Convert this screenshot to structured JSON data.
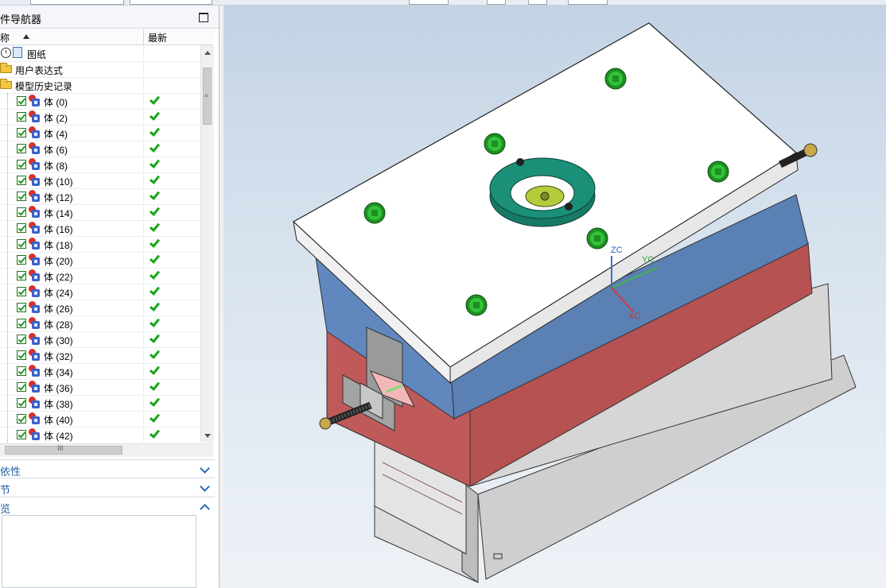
{
  "navigator": {
    "title": "件导航器",
    "columns": {
      "name": "称",
      "latest": "最新"
    },
    "items": [
      {
        "label": "图纸"
      },
      {
        "label": "用户表达式"
      },
      {
        "label": "模型历史记录"
      }
    ],
    "bodies": [
      "体 (0)",
      "体 (2)",
      "体 (4)",
      "体 (6)",
      "体 (8)",
      "体 (10)",
      "体 (12)",
      "体 (14)",
      "体 (16)",
      "体 (18)",
      "体 (20)",
      "体 (22)",
      "体 (24)",
      "体 (26)",
      "体 (28)",
      "体 (30)",
      "体 (32)",
      "体 (34)",
      "体 (36)",
      "体 (38)",
      "体 (40)",
      "体 (42)"
    ],
    "hscroll_grip": "III",
    "vscroll_grip": "≡"
  },
  "sections": {
    "dependency": "依性",
    "details": "节",
    "preview": "览"
  },
  "viewport": {
    "axis_labels": {
      "zc": "ZC",
      "yc": "YC",
      "xc": "XC"
    },
    "colors": {
      "plate_top": "#ffffff",
      "plate_blue": "#5a80b4",
      "plate_red": "#b75656",
      "plate_gray": "#d4d4d4",
      "screw_green": "#29b32c",
      "ring_teal": "#1b8f78"
    }
  }
}
